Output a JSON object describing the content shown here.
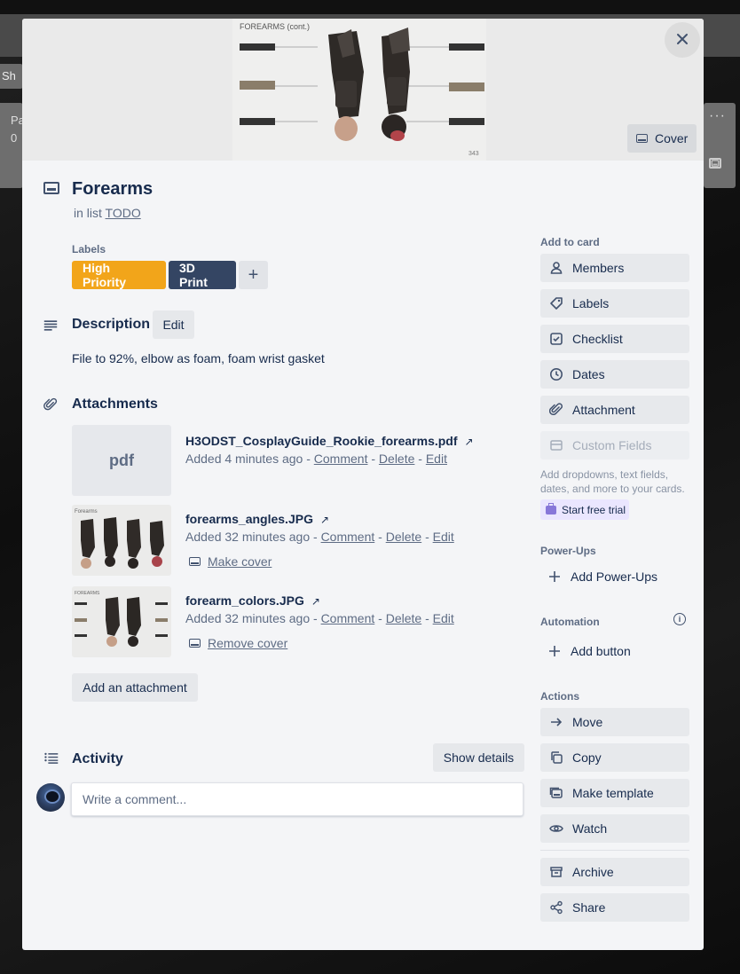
{
  "background": {
    "share_label": "Sh",
    "list_title": "Pa",
    "list_count": "0"
  },
  "cover": {
    "close_label": "×",
    "cover_button_label": "Cover",
    "image_heading": "FOREARMS (cont.)"
  },
  "card": {
    "title": "Forearms",
    "in_list_prefix": "in list",
    "list_name": "TODO"
  },
  "labels": {
    "heading": "Labels",
    "items": [
      {
        "text": "High Priority",
        "color": "#f2a51a"
      },
      {
        "text": "3D Print",
        "color": "#344563"
      }
    ],
    "add_label": "+"
  },
  "description": {
    "title": "Description",
    "edit_label": "Edit",
    "text": "File to 92%, elbow as foam, foam wrist gasket"
  },
  "attachments": {
    "title": "Attachments",
    "items": [
      {
        "thumb_text": "pdf",
        "name": "H3ODST_CosplayGuide_Rookie_forearms.pdf",
        "added": "Added 4 minutes ago",
        "comment": "Comment",
        "delete": "Delete",
        "edit": "Edit"
      },
      {
        "name": "forearms_angles.JPG",
        "added": "Added 32 minutes ago",
        "comment": "Comment",
        "delete": "Delete",
        "edit": "Edit",
        "cover_action": "Make cover"
      },
      {
        "name": "forearm_colors.JPG",
        "added": "Added 32 minutes ago",
        "comment": "Comment",
        "delete": "Delete",
        "edit": "Edit",
        "cover_action": "Remove cover"
      }
    ],
    "separator": "-",
    "external_arrow": "↗",
    "add_label": "Add an attachment"
  },
  "activity": {
    "title": "Activity",
    "show_details": "Show details",
    "comment_placeholder": "Write a comment..."
  },
  "sidebar": {
    "add_to_card": {
      "heading": "Add to card",
      "items": [
        {
          "label": "Members",
          "icon": "person-icon"
        },
        {
          "label": "Labels",
          "icon": "tag-icon"
        },
        {
          "label": "Checklist",
          "icon": "checkbox-icon"
        },
        {
          "label": "Dates",
          "icon": "clock-icon"
        },
        {
          "label": "Attachment",
          "icon": "paperclip-icon"
        },
        {
          "label": "Custom Fields",
          "icon": "fields-icon"
        }
      ],
      "help_text": "Add dropdowns, text fields, dates, and more to your cards.",
      "trial_label": "Start free trial"
    },
    "power_ups": {
      "heading": "Power-Ups",
      "add_label": "Add Power-Ups"
    },
    "automation": {
      "heading": "Automation",
      "add_label": "Add button",
      "info_glyph": "i"
    },
    "actions": {
      "heading": "Actions",
      "items": [
        {
          "label": "Move",
          "icon": "arrow-right-icon"
        },
        {
          "label": "Copy",
          "icon": "copy-icon"
        },
        {
          "label": "Make template",
          "icon": "template-icon"
        },
        {
          "label": "Watch",
          "icon": "eye-icon"
        },
        {
          "label": "Archive",
          "icon": "archive-icon"
        },
        {
          "label": "Share",
          "icon": "share-icon"
        }
      ]
    }
  },
  "colors": {
    "modal_bg": "#f4f5f7",
    "button_bg": "#e7e9ec",
    "text": "#172b4d",
    "muted": "#5e6c84",
    "high_priority": "#f2a51a",
    "print_label": "#344563",
    "trial_bg": "#eae6ff"
  }
}
